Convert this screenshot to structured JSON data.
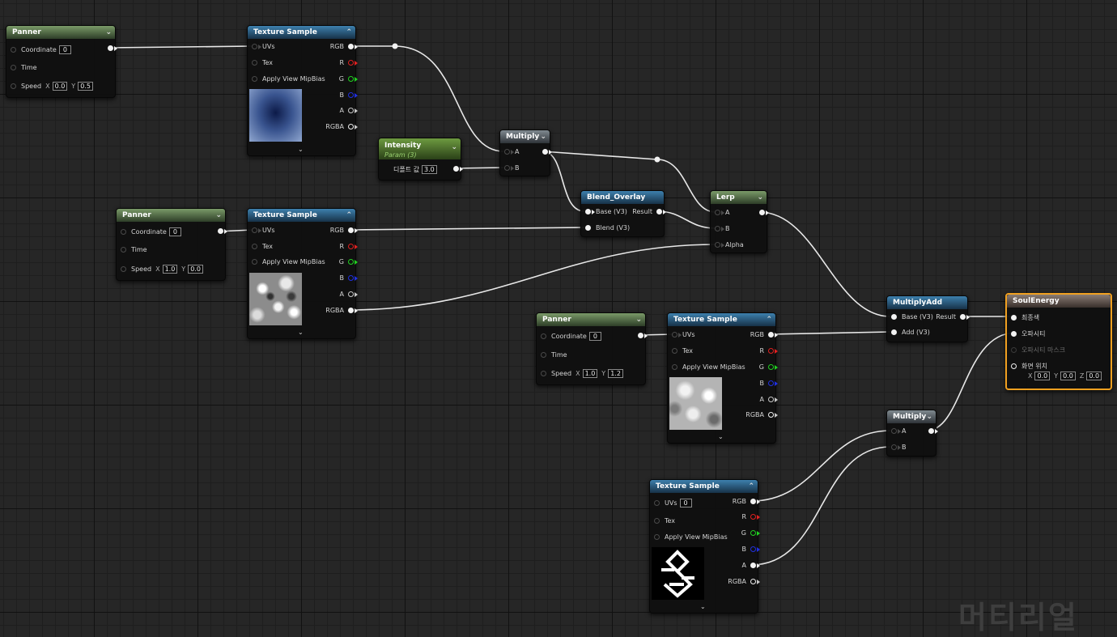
{
  "panner": {
    "title": "Panner",
    "coordinate": "Coordinate",
    "time": "Time",
    "speed": "Speed",
    "x_label": "X",
    "y_label": "Y"
  },
  "panner1": {
    "coord_value": "0",
    "speed_x": "0.0",
    "speed_y": "0.5"
  },
  "panner2": {
    "coord_value": "0",
    "speed_x": "1.0",
    "speed_y": "0.0"
  },
  "panner3": {
    "coord_value": "0",
    "speed_x": "1.0",
    "speed_y": "1.2"
  },
  "texsample": {
    "title": "Texture Sample",
    "uvs": "UVs",
    "tex": "Tex",
    "mip": "Apply View MipBias",
    "rgb": "RGB",
    "r": "R",
    "g": "G",
    "b": "B",
    "a": "A",
    "rgba": "RGBA",
    "uvs_value": "0"
  },
  "intensity": {
    "title": "Intensity",
    "subtitle": "Param (3)",
    "pin_label": "디폴트 값",
    "value": "3.0"
  },
  "multiply": {
    "title": "Multiply",
    "a": "A",
    "b": "B"
  },
  "blend": {
    "title": "Blend_Overlay",
    "base": "Base (V3)",
    "blend": "Blend (V3)",
    "result": "Result"
  },
  "lerp": {
    "title": "Lerp",
    "a": "A",
    "b": "B",
    "alpha": "Alpha"
  },
  "multiplyadd": {
    "title": "MultiplyAdd",
    "base": "Base (V3)",
    "add": "Add (V3)",
    "result": "Result"
  },
  "soul": {
    "title": "SoulEnergy",
    "emissive": "최종색",
    "opacity": "오파시티",
    "opacity_mask": "오파시티 마스크",
    "world_offset": "화면 위치",
    "x_label": "X",
    "y_label": "Y",
    "z_label": "Z",
    "x": "0.0",
    "y": "0.0",
    "z": "0.0"
  },
  "watermark": "머티리얼",
  "colors": {
    "wire": "#e8e8e8",
    "selected": "#f0a020",
    "panner_header": "#5b7a4c",
    "texture_header": "#2c6a98",
    "param_header": "#5b8a34"
  }
}
